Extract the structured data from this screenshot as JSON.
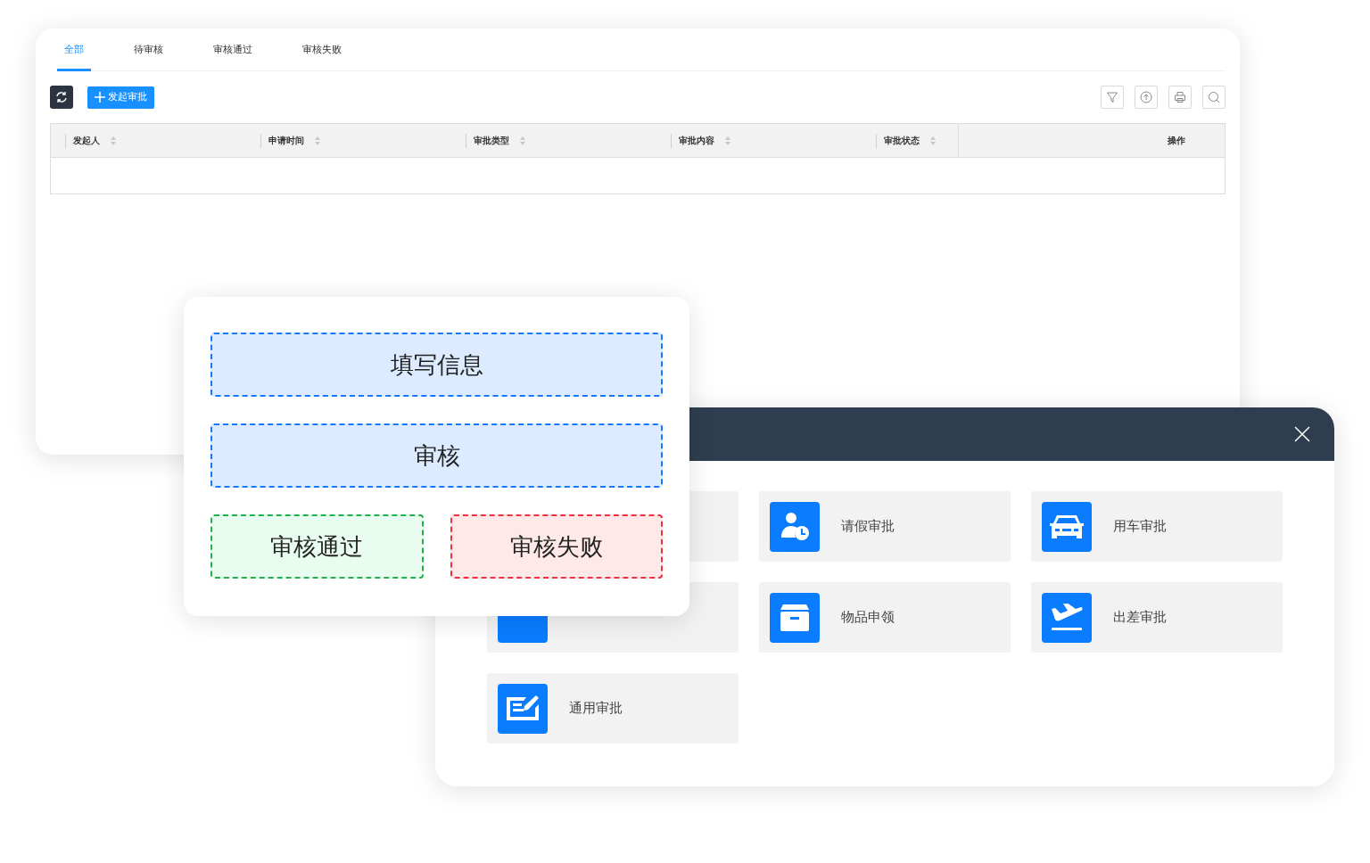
{
  "list_window": {
    "tabs": [
      {
        "label": "全部",
        "selected": true
      },
      {
        "label": "待审核",
        "selected": false
      },
      {
        "label": "审核通过",
        "selected": false
      },
      {
        "label": "审核失败",
        "selected": false
      }
    ],
    "new_button": "发起审批",
    "table": {
      "columns": [
        {
          "label": "发起人",
          "sortable": true
        },
        {
          "label": "申请时间",
          "sortable": true
        },
        {
          "label": "审批类型",
          "sortable": true
        },
        {
          "label": "审批内容",
          "sortable": true
        },
        {
          "label": "审批状态",
          "sortable": true
        },
        {
          "label": "操作",
          "sortable": false
        }
      ]
    }
  },
  "type_dialog": {
    "tiles": [
      {
        "kind": "covered"
      },
      {
        "kind": "person-clock",
        "label": "请假审批"
      },
      {
        "kind": "car",
        "label": "用车审批"
      },
      {
        "kind": "covered-icon"
      },
      {
        "kind": "box",
        "label": "物品申领"
      },
      {
        "kind": "plane",
        "label": "出差审批"
      },
      {
        "kind": "form",
        "label": "通用审批"
      }
    ]
  },
  "flow_card": {
    "steps": [
      {
        "kind": "info",
        "label": "填写信息"
      },
      {
        "kind": "info",
        "label": "审核"
      },
      {
        "kind": "pass",
        "label": "审核通过"
      },
      {
        "kind": "fail",
        "label": "审核失败"
      }
    ]
  }
}
